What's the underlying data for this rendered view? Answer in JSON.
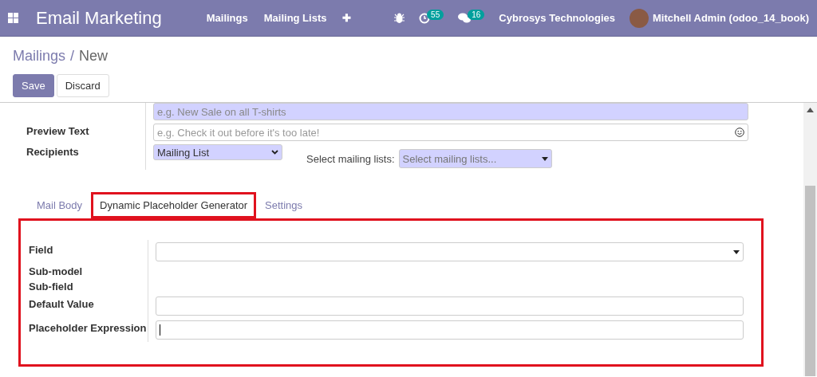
{
  "navbar": {
    "app_title": "Email Marketing",
    "menus": [
      "Mailings",
      "Mailing Lists",
      "✚"
    ],
    "activity_count": "55",
    "message_count": "16",
    "company": "Cybrosys Technologies",
    "user": "Mitchell Admin (odoo_14_book)"
  },
  "breadcrumb": {
    "parent": "Mailings",
    "separator": "/",
    "current": "New"
  },
  "buttons": [
    {
      "label": "Save",
      "kind": "primary"
    },
    {
      "label": "Discard",
      "kind": "secondary"
    }
  ],
  "form": {
    "subject_placeholder": "e.g. New Sale on all T-shirts",
    "preview_label": "Preview Text",
    "preview_placeholder": "e.g. Check it out before it's too late!",
    "recipients_label": "Recipients",
    "recipients_value": "Mailing List",
    "lists_label": "Select mailing lists:",
    "lists_placeholder": "Select mailing lists..."
  },
  "tabs": [
    {
      "label": "Mail Body",
      "selected": false,
      "highlighted": false
    },
    {
      "label": "Dynamic Placeholder Generator",
      "selected": true,
      "highlighted": true
    },
    {
      "label": "Settings",
      "selected": false,
      "highlighted": false
    }
  ],
  "tab_panel": {
    "highlighted": true,
    "fields": [
      {
        "label": "Field",
        "kind": "select"
      },
      {
        "label": "Sub-model",
        "kind": "none"
      },
      {
        "label": "Sub-field",
        "kind": "none"
      },
      {
        "label": "Default Value",
        "kind": "text"
      },
      {
        "label": "Placeholder Expression",
        "kind": "text",
        "focused": true
      }
    ]
  }
}
